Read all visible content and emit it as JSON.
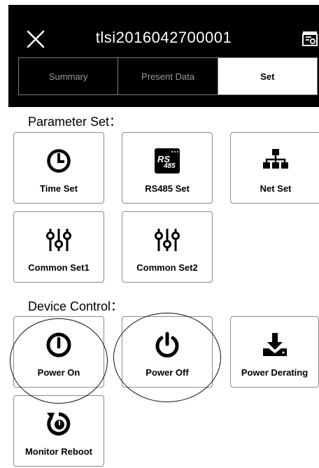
{
  "header": {
    "title": "tlsi2016042700001",
    "close_icon": "close-icon",
    "right_icon": "document-settings-icon"
  },
  "tabs": [
    {
      "label": "Summary",
      "active": false
    },
    {
      "label": "Present Data",
      "active": false
    },
    {
      "label": "Set",
      "active": true
    }
  ],
  "parameter": {
    "heading": "Parameter Set：",
    "items": [
      {
        "label": "Time Set",
        "icon": "clock-icon"
      },
      {
        "label": "RS485 Set",
        "icon": "rs485-icon",
        "badge_top": "RS",
        "badge_bottom": "485"
      },
      {
        "label": "Net Set",
        "icon": "network-icon"
      },
      {
        "label": "Common Set1",
        "icon": "sliders-icon"
      },
      {
        "label": "Common Set2",
        "icon": "sliders-icon"
      }
    ]
  },
  "device": {
    "heading": "Device Control：",
    "items": [
      {
        "label": "Power On",
        "icon": "power-on-icon"
      },
      {
        "label": "Power Off",
        "icon": "power-off-icon"
      },
      {
        "label": "Power Derating",
        "icon": "download-tray-icon"
      },
      {
        "label": "Monitor Reboot",
        "icon": "reboot-icon"
      }
    ]
  },
  "colors": {
    "header_bg": "#000000",
    "accent": "#000000",
    "border": "#8a8a8a"
  }
}
